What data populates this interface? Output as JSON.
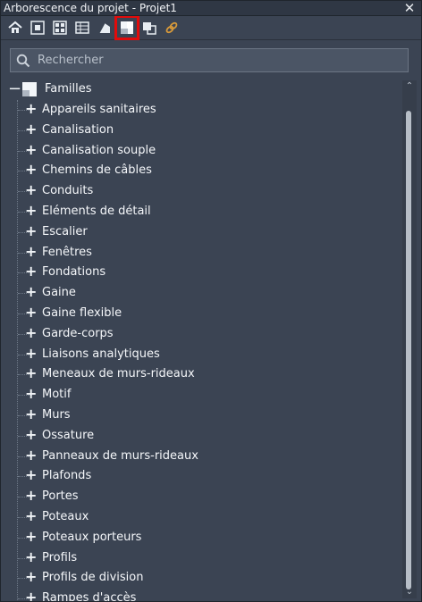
{
  "window": {
    "title": "Arborescence du projet - Projet1",
    "close_symbol": "✕"
  },
  "toolbar": {
    "buttons": [
      {
        "icon": "home-icon"
      },
      {
        "icon": "focus-view-icon"
      },
      {
        "icon": "grid-view-icon"
      },
      {
        "icon": "table-icon"
      },
      {
        "icon": "sheet-icon"
      },
      {
        "icon": "families-icon",
        "selected": true
      },
      {
        "icon": "groups-icon"
      },
      {
        "icon": "link-icon"
      }
    ],
    "highlight_color": "#e10b0b"
  },
  "search": {
    "placeholder": "Rechercher",
    "value": ""
  },
  "tree": {
    "root": {
      "toggle": "−",
      "label": "Familles"
    },
    "expand_symbol": "+",
    "items": [
      "Appareils sanitaires",
      "Canalisation",
      "Canalisation souple",
      "Chemins de câbles",
      "Conduits",
      "Eléments de détail",
      "Escalier",
      "Fenêtres",
      "Fondations",
      "Gaine",
      "Gaine flexible",
      "Garde-corps",
      "Liaisons analytiques",
      "Meneaux de murs-rideaux",
      "Motif",
      "Murs",
      "Ossature",
      "Panneaux de murs-rideaux",
      "Plafonds",
      "Portes",
      "Poteaux",
      "Poteaux porteurs",
      "Profils",
      "Profils de division",
      "Rampes d'accès"
    ]
  },
  "scrollbar": {
    "up": "⌃",
    "down": "⌄"
  },
  "colors": {
    "panel_bg": "#3b4453",
    "text": "#f5f7fa"
  }
}
